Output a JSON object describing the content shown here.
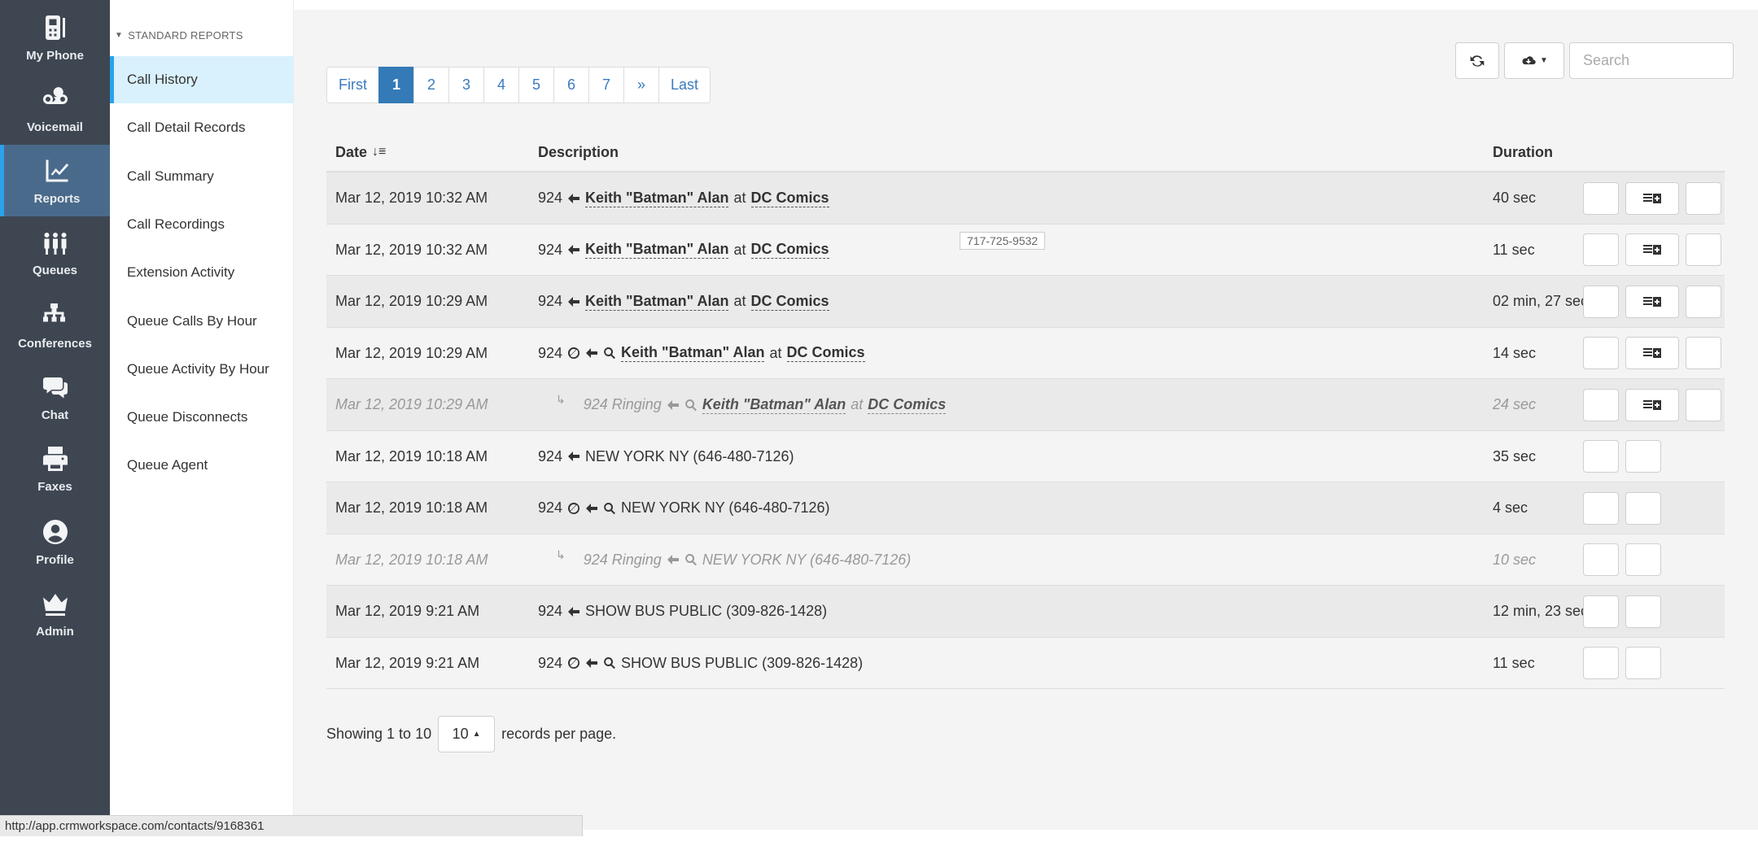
{
  "rail": [
    {
      "label": "My Phone",
      "icon": "phone-icon"
    },
    {
      "label": "Voicemail",
      "icon": "voicemail-icon"
    },
    {
      "label": "Reports",
      "icon": "chart-icon",
      "active": true
    },
    {
      "label": "Queues",
      "icon": "users-icon"
    },
    {
      "label": "Conferences",
      "icon": "sitemap-icon"
    },
    {
      "label": "Chat",
      "icon": "chat-icon"
    },
    {
      "label": "Faxes",
      "icon": "printer-icon"
    },
    {
      "label": "Profile",
      "icon": "user-circle-icon"
    },
    {
      "label": "Admin",
      "icon": "crown-icon"
    }
  ],
  "subnav": {
    "header": "STANDARD REPORTS",
    "items": [
      {
        "label": "Call History",
        "active": true
      },
      {
        "label": "Call Detail Records"
      },
      {
        "label": "Call Summary"
      },
      {
        "label": "Call Recordings"
      },
      {
        "label": "Extension Activity"
      },
      {
        "label": "Queue Calls By Hour"
      },
      {
        "label": "Queue Activity By Hour"
      },
      {
        "label": "Queue Disconnects"
      },
      {
        "label": "Queue Agent"
      }
    ]
  },
  "pager": [
    "First",
    "1",
    "2",
    "3",
    "4",
    "5",
    "6",
    "7",
    "»",
    "Last"
  ],
  "pager_active": "1",
  "search": {
    "placeholder": "Search"
  },
  "table": {
    "headers": {
      "date": "Date",
      "description": "Description",
      "duration": "Duration"
    },
    "rows": [
      {
        "date": "Mar 12, 2019 10:32 AM",
        "ext": "924",
        "blocked": false,
        "search": false,
        "contact": "Keith \"Batman\" Alan",
        "at": "at",
        "company": "DC Comics",
        "duration": "40 sec",
        "actions": [
          "block",
          "record",
          "mic"
        ]
      },
      {
        "date": "Mar 12, 2019 10:32 AM",
        "ext": "924",
        "blocked": false,
        "search": false,
        "contact": "Keith \"Batman\" Alan",
        "at": "at",
        "company": "DC Comics",
        "duration": "11 sec",
        "actions": [
          "block",
          "record",
          "mic"
        ]
      },
      {
        "date": "Mar 12, 2019 10:29 AM",
        "ext": "924",
        "blocked": false,
        "search": false,
        "contact": "Keith \"Batman\" Alan",
        "at": "at",
        "company": "DC Comics",
        "duration": "02 min, 27 sec",
        "actions": [
          "block",
          "record",
          "mic"
        ]
      },
      {
        "date": "Mar 12, 2019 10:29 AM",
        "ext": "924",
        "blocked": true,
        "search": true,
        "contact": "Keith \"Batman\" Alan",
        "at": "at",
        "company": "DC Comics",
        "duration": "14 sec",
        "actions": [
          "block",
          "record",
          "mic"
        ]
      },
      {
        "date": "Mar 12, 2019 10:29 AM",
        "ext": "924 Ringing",
        "sub": true,
        "search": true,
        "contact": "Keith \"Batman\" Alan",
        "at": "at",
        "company": "DC Comics",
        "duration": "24 sec",
        "actions": [
          "block",
          "record",
          "mic"
        ]
      },
      {
        "date": "Mar 12, 2019 10:18 AM",
        "ext": "924",
        "blocked": false,
        "search": false,
        "caller": "NEW YORK NY (646-480-7126)",
        "duration": "35 sec",
        "actions": [
          "block",
          "mic"
        ]
      },
      {
        "date": "Mar 12, 2019 10:18 AM",
        "ext": "924",
        "blocked": true,
        "search": true,
        "caller": "NEW YORK NY (646-480-7126)",
        "duration": "4 sec",
        "actions": [
          "block",
          "mic"
        ]
      },
      {
        "date": "Mar 12, 2019 10:18 AM",
        "ext": "924 Ringing",
        "sub": true,
        "search": true,
        "caller": "NEW YORK NY (646-480-7126)",
        "duration": "10 sec",
        "actions": [
          "block",
          "mic"
        ]
      },
      {
        "date": "Mar 12, 2019 9:21 AM",
        "ext": "924",
        "blocked": false,
        "search": false,
        "caller": "SHOW BUS PUBLIC (309-826-1428)",
        "duration": "12 min, 23 sec",
        "actions": [
          "block",
          "mic"
        ]
      },
      {
        "date": "Mar 12, 2019 9:21 AM",
        "ext": "924",
        "blocked": true,
        "search": true,
        "caller": "SHOW BUS PUBLIC (309-826-1428)",
        "duration": "11 sec",
        "actions": [
          "block",
          "mic"
        ]
      }
    ]
  },
  "tooltip": "717-725-9532",
  "footer": {
    "showing": "Showing 1 to 10",
    "per_page": "10",
    "suffix": "records per page."
  },
  "statusbar": "http://app.crmworkspace.com/contacts/9168361",
  "colors": {
    "rail": "#3e4651",
    "accent": "#2aa2ec",
    "pager_active": "#337ab7"
  }
}
